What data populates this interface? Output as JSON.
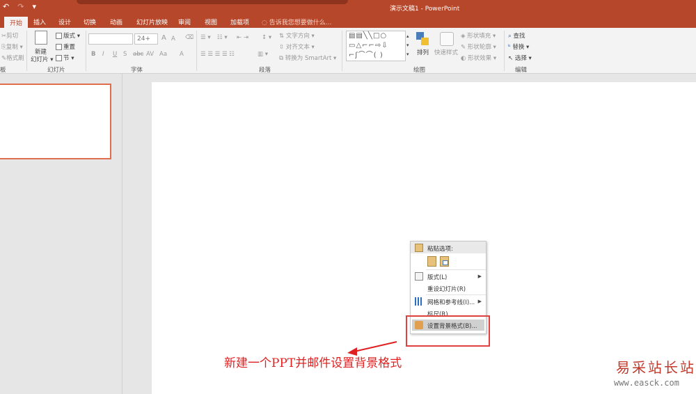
{
  "window": {
    "title": "演示文稿1 - PowerPoint"
  },
  "qat": {
    "undo": "↶",
    "redo": "↷",
    "customize": "▾"
  },
  "tabs": [
    "开始",
    "插入",
    "设计",
    "切换",
    "动画",
    "幻灯片放映",
    "审阅",
    "视图",
    "加载项"
  ],
  "tell_me": "告诉我您想要做什么...",
  "ribbon": {
    "clipboard": {
      "cut": "剪切",
      "copy": "复制",
      "format_painter": "格式刷",
      "label": "板"
    },
    "slides": {
      "new_slide_1": "新建",
      "new_slide_2": "幻灯片",
      "layout": "版式",
      "reset": "重置",
      "section": "节",
      "label": "幻灯片"
    },
    "font": {
      "size": "24+",
      "label": "字体",
      "bold": "B",
      "italic": "I",
      "underline": "U",
      "shadow": "S",
      "strike": "abc",
      "spacing": "AV",
      "case": "Aa",
      "color": "A",
      "grow": "A",
      "shrink": "A"
    },
    "paragraph": {
      "text_direction": "文字方向",
      "align_text": "对齐文本",
      "smartart": "转换为 SmartArt",
      "label": "段落"
    },
    "drawing": {
      "arrange": "排列",
      "quick_styles": "快速样式",
      "shape_fill": "形状填充",
      "shape_outline": "形状轮廓",
      "shape_effects": "形状效果",
      "label": "绘图"
    },
    "editing": {
      "find": "查找",
      "replace": "替换",
      "select": "选择",
      "label": "编辑"
    }
  },
  "context_menu": {
    "paste_options": "粘贴选项:",
    "layout": "版式(L)",
    "reset_slide": "重设幻灯片(R)",
    "grid_guides": "网格和参考线(I)...",
    "ruler": "标尺(R)",
    "format_background": "设置背景格式(B)..."
  },
  "annotation": "新建一个PPT并邮件设置背景格式",
  "watermark": {
    "text": "易采站长站",
    "url": "www.easck.com"
  },
  "colors": {
    "accent": "#b7472a",
    "annotation_red": "#e02020"
  }
}
